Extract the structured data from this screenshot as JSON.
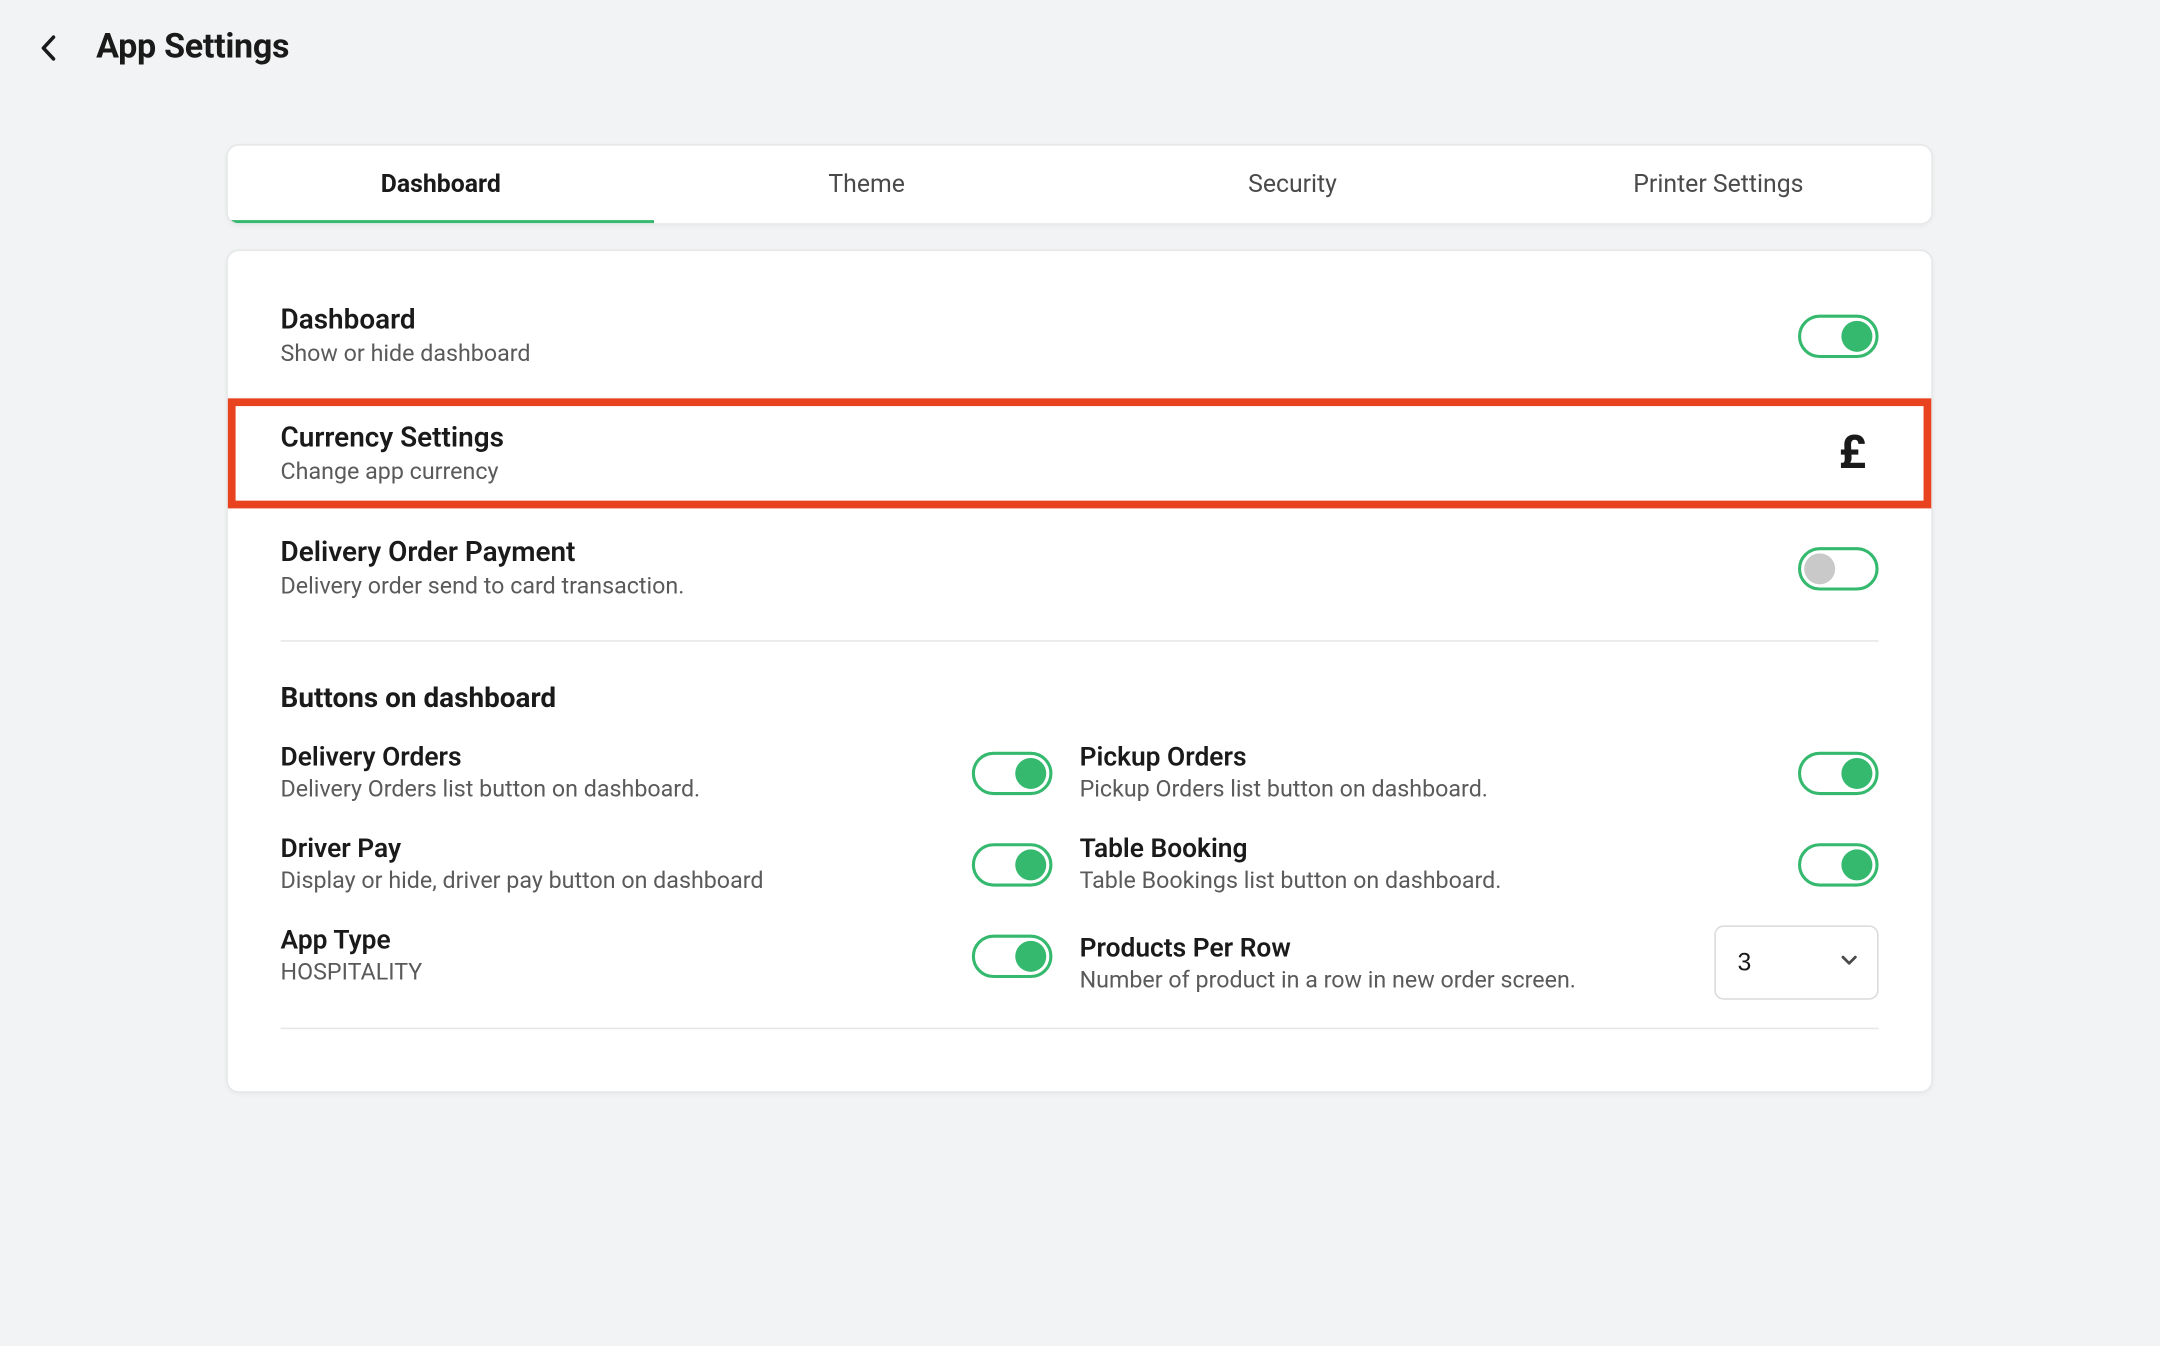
{
  "header": {
    "title": "App Settings"
  },
  "tabs": [
    {
      "label": "Dashboard",
      "active": true
    },
    {
      "label": "Theme",
      "active": false
    },
    {
      "label": "Security",
      "active": false
    },
    {
      "label": "Printer Settings",
      "active": false
    }
  ],
  "settings": {
    "dashboard": {
      "title": "Dashboard",
      "desc": "Show or hide dashboard",
      "on": true
    },
    "currency": {
      "title": "Currency Settings",
      "desc": "Change app currency",
      "symbol": "£"
    },
    "delivery_payment": {
      "title": "Delivery Order Payment",
      "desc": "Delivery order send to card transaction.",
      "on": false
    }
  },
  "buttons_section": {
    "heading": "Buttons on dashboard",
    "delivery_orders": {
      "title": "Delivery Orders",
      "desc": "Delivery Orders list button on dashboard.",
      "on": true
    },
    "pickup_orders": {
      "title": "Pickup Orders",
      "desc": "Pickup Orders list button on dashboard.",
      "on": true
    },
    "driver_pay": {
      "title": "Driver Pay",
      "desc": "Display or hide, driver pay button on dashboard",
      "on": true
    },
    "table_booking": {
      "title": "Table Booking",
      "desc": "Table Bookings list button on dashboard.",
      "on": true
    },
    "app_type": {
      "title": "App Type",
      "desc": "HOSPITALITY",
      "on": true
    },
    "products_per_row": {
      "title": "Products Per Row",
      "desc": "Number of product in a row in new order screen.",
      "value": "3"
    }
  }
}
